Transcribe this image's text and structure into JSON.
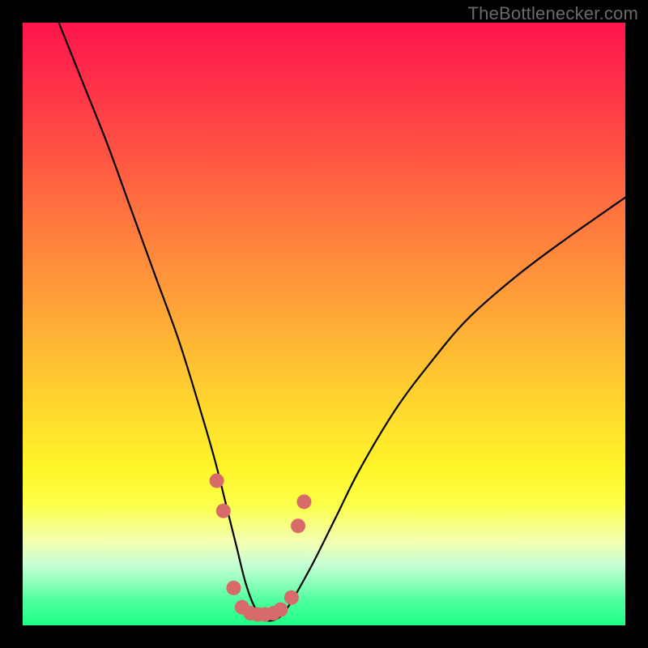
{
  "watermark": "TheBottlenecker.com",
  "colors": {
    "frame": "#000000",
    "curve_stroke": "#000000",
    "marker_fill": "#d86a6a",
    "marker_stroke": "#b94f4f"
  },
  "chart_data": {
    "type": "line",
    "title": "",
    "xlabel": "",
    "ylabel": "",
    "xlim": [
      0,
      100
    ],
    "ylim": [
      0,
      100
    ],
    "x": [
      6,
      10,
      14,
      18,
      22,
      26,
      30,
      32,
      34,
      35.5,
      37,
      38.5,
      40,
      42,
      44,
      48,
      52,
      56,
      62,
      68,
      74,
      82,
      90,
      100
    ],
    "values": [
      100,
      90,
      80,
      69,
      58,
      47,
      34,
      27,
      19,
      13,
      7,
      3,
      1,
      1,
      3,
      10,
      18,
      26,
      36,
      44,
      51,
      58,
      64,
      71
    ],
    "markers": {
      "x": [
        32.2,
        33.3,
        35.0,
        36.4,
        37.8,
        39.0,
        40.2,
        41.6,
        42.8,
        44.6,
        45.7,
        46.7
      ],
      "y": [
        24.0,
        19.0,
        6.2,
        3.0,
        2.0,
        1.8,
        1.8,
        2.0,
        2.6,
        4.6,
        16.5,
        20.5
      ]
    }
  }
}
